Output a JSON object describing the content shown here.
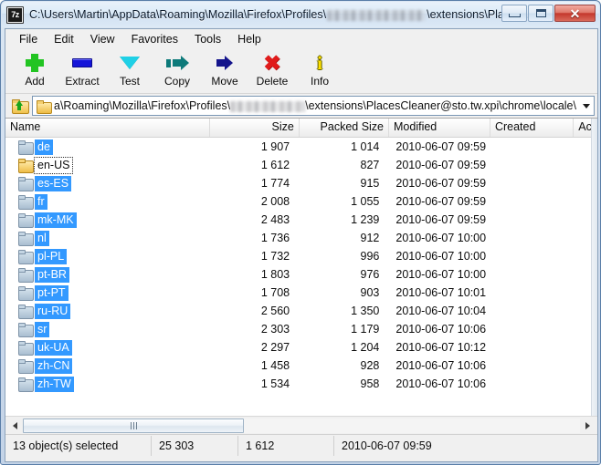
{
  "window": {
    "title_prefix": "C:\\Users\\Martin\\AppData\\Roaming\\Mozilla\\Firefox\\Profiles\\",
    "title_suffix": "\\extensions\\Places...",
    "logo_text": "7z",
    "controls": {
      "minimize": "minimize-button",
      "maximize": "maximize-button",
      "close": "close-button"
    }
  },
  "menubar": {
    "items": [
      {
        "label": "File"
      },
      {
        "label": "Edit"
      },
      {
        "label": "View"
      },
      {
        "label": "Favorites"
      },
      {
        "label": "Tools"
      },
      {
        "label": "Help"
      }
    ]
  },
  "toolbar": {
    "buttons": [
      {
        "label": "Add",
        "icon": "plus-icon"
      },
      {
        "label": "Extract",
        "icon": "extract-bar-icon"
      },
      {
        "label": "Test",
        "icon": "chevron-down-icon"
      },
      {
        "label": "Copy",
        "icon": "copy-arrow-icon"
      },
      {
        "label": "Move",
        "icon": "move-arrow-icon"
      },
      {
        "label": "Delete",
        "icon": "delete-x-icon"
      },
      {
        "label": "Info",
        "icon": "info-icon"
      }
    ]
  },
  "addressbar": {
    "up_icon": "folder-up-icon",
    "folder_icon": "folder-icon",
    "path_prefix": "a\\Roaming\\Mozilla\\Firefox\\Profiles\\",
    "path_suffix": "\\extensions\\PlacesCleaner@sto.tw.xpi\\chrome\\locale\\",
    "dropdown_icon": "chevron-down-icon"
  },
  "listview": {
    "columns": [
      {
        "key": "name",
        "label": "Name",
        "align": "left"
      },
      {
        "key": "size",
        "label": "Size",
        "align": "right"
      },
      {
        "key": "packed",
        "label": "Packed Size",
        "align": "right"
      },
      {
        "key": "mod",
        "label": "Modified",
        "align": "left"
      },
      {
        "key": "crt",
        "label": "Created",
        "align": "left"
      },
      {
        "key": "acc",
        "label": "Ac",
        "align": "left"
      }
    ],
    "rows": [
      {
        "name": "de",
        "size": "1 907",
        "packed": "1 014",
        "mod": "2010-06-07 09:59",
        "crt": "",
        "selected": true,
        "focused": false
      },
      {
        "name": "en-US",
        "size": "1 612",
        "packed": "827",
        "mod": "2010-06-07 09:59",
        "crt": "",
        "selected": false,
        "focused": true
      },
      {
        "name": "es-ES",
        "size": "1 774",
        "packed": "915",
        "mod": "2010-06-07 09:59",
        "crt": "",
        "selected": true,
        "focused": false
      },
      {
        "name": "fr",
        "size": "2 008",
        "packed": "1 055",
        "mod": "2010-06-07 09:59",
        "crt": "",
        "selected": true,
        "focused": false
      },
      {
        "name": "mk-MK",
        "size": "2 483",
        "packed": "1 239",
        "mod": "2010-06-07 09:59",
        "crt": "",
        "selected": true,
        "focused": false
      },
      {
        "name": "nl",
        "size": "1 736",
        "packed": "912",
        "mod": "2010-06-07 10:00",
        "crt": "",
        "selected": true,
        "focused": false
      },
      {
        "name": "pl-PL",
        "size": "1 732",
        "packed": "996",
        "mod": "2010-06-07 10:00",
        "crt": "",
        "selected": true,
        "focused": false
      },
      {
        "name": "pt-BR",
        "size": "1 803",
        "packed": "976",
        "mod": "2010-06-07 10:00",
        "crt": "",
        "selected": true,
        "focused": false
      },
      {
        "name": "pt-PT",
        "size": "1 708",
        "packed": "903",
        "mod": "2010-06-07 10:01",
        "crt": "",
        "selected": true,
        "focused": false
      },
      {
        "name": "ru-RU",
        "size": "2 560",
        "packed": "1 350",
        "mod": "2010-06-07 10:04",
        "crt": "",
        "selected": true,
        "focused": false
      },
      {
        "name": "sr",
        "size": "2 303",
        "packed": "1 179",
        "mod": "2010-06-07 10:06",
        "crt": "",
        "selected": true,
        "focused": false
      },
      {
        "name": "uk-UA",
        "size": "2 297",
        "packed": "1 204",
        "mod": "2010-06-07 10:12",
        "crt": "",
        "selected": true,
        "focused": false
      },
      {
        "name": "zh-CN",
        "size": "1 458",
        "packed": "928",
        "mod": "2010-06-07 10:06",
        "crt": "",
        "selected": true,
        "focused": false
      },
      {
        "name": "zh-TW",
        "size": "1 534",
        "packed": "958",
        "mod": "2010-06-07 10:06",
        "crt": "",
        "selected": true,
        "focused": false
      }
    ]
  },
  "statusbar": {
    "selection": "13 object(s) selected",
    "total_size": "25 303",
    "total_packed": "1 612",
    "modified": "2010-06-07 09:59"
  },
  "colors": {
    "selection_blue": "#3399ff",
    "close_red": "#c4382c",
    "add_green": "#22c422",
    "delete_red": "#e01b1b",
    "info_yellow": "#ffe000",
    "folder_yellow": "#eebd48"
  }
}
